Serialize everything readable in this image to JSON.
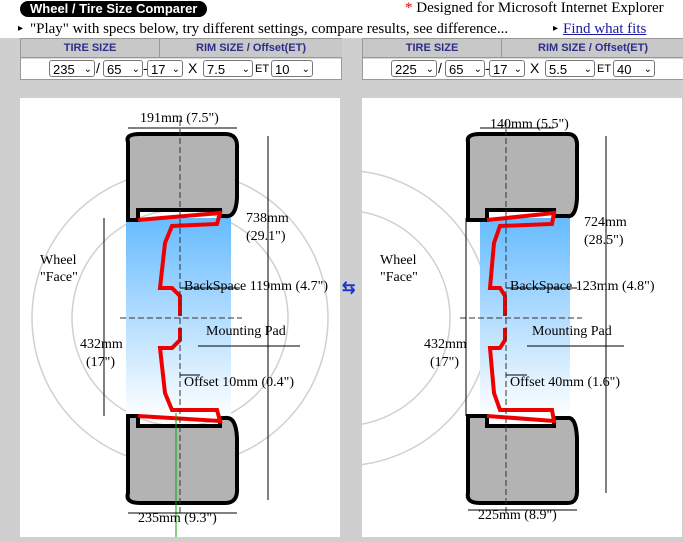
{
  "app": {
    "title": "Wheel / Tire Size Comparer"
  },
  "header": {
    "designed_star": "*",
    "designed_text": "Designed for Microsoft Internet Explorer"
  },
  "info": {
    "instruction": "\"Play\" with specs below, try different settings, compare results, see difference...",
    "link": "Find what fits"
  },
  "panel_headers": {
    "tire_size": "TIRE SIZE",
    "rim_size": "RIM SIZE / Offset(ET)",
    "x": "X",
    "et": "ET"
  },
  "left": {
    "width": "235",
    "ratio": "65",
    "diameter": "17",
    "rim_width": "7.5",
    "offset": "10",
    "labels": {
      "width_top": "191mm (7.5\")",
      "height_mm": "738mm",
      "height_in": "(29.1\")",
      "wheel": "Wheel",
      "face": "\"Face\"",
      "backspace": "BackSpace 119mm (4.7\")",
      "mounting_pad": "Mounting Pad",
      "rim_mm": "432mm",
      "rim_in": "(17\")",
      "offset": "Offset 10mm (0.4\")",
      "width_bottom": "235mm (9.3\")"
    }
  },
  "right": {
    "width": "225",
    "ratio": "65",
    "diameter": "17",
    "rim_width": "5.5",
    "offset": "40",
    "labels": {
      "width_top": "140mm (5.5\")",
      "height_mm": "724mm",
      "height_in": "(28.5\")",
      "wheel": "Wheel",
      "face": "\"Face\"",
      "backspace": "BackSpace 123mm (4.8\")",
      "mounting_pad": "Mounting Pad",
      "rim_mm": "432mm",
      "rim_in": "(17\")",
      "offset": "Offset 40mm (1.6\")",
      "width_bottom": "225mm (8.9\")"
    }
  },
  "swap_icon": "⇆"
}
